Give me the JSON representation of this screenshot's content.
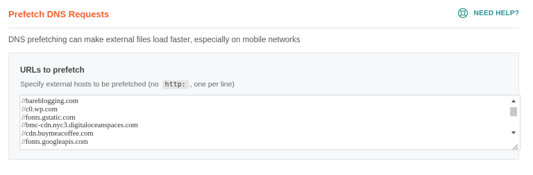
{
  "header": {
    "title": "Prefetch DNS Requests",
    "help_label": "NEED HELP?",
    "help_icon": "lifebuoy-icon"
  },
  "description": "DNS prefetching can make external files load faster, especially on mobile networks",
  "field": {
    "label": "URLs to prefetch",
    "help_prefix": "Specify external hosts to be prefetched (no",
    "help_code": "http:",
    "help_suffix": ", one per line)",
    "lines": [
      "//bareblogging.com",
      "//c0.wp.com",
      "//fonts.gstatic.com",
      "//bmc-cdn.nyc3.digitaloceanspaces.com",
      "//cdn.buymeacoffee.com",
      "//fonts.googleapis.com"
    ]
  },
  "colors": {
    "title": "#f1602f",
    "help": "#2c8f8e"
  }
}
